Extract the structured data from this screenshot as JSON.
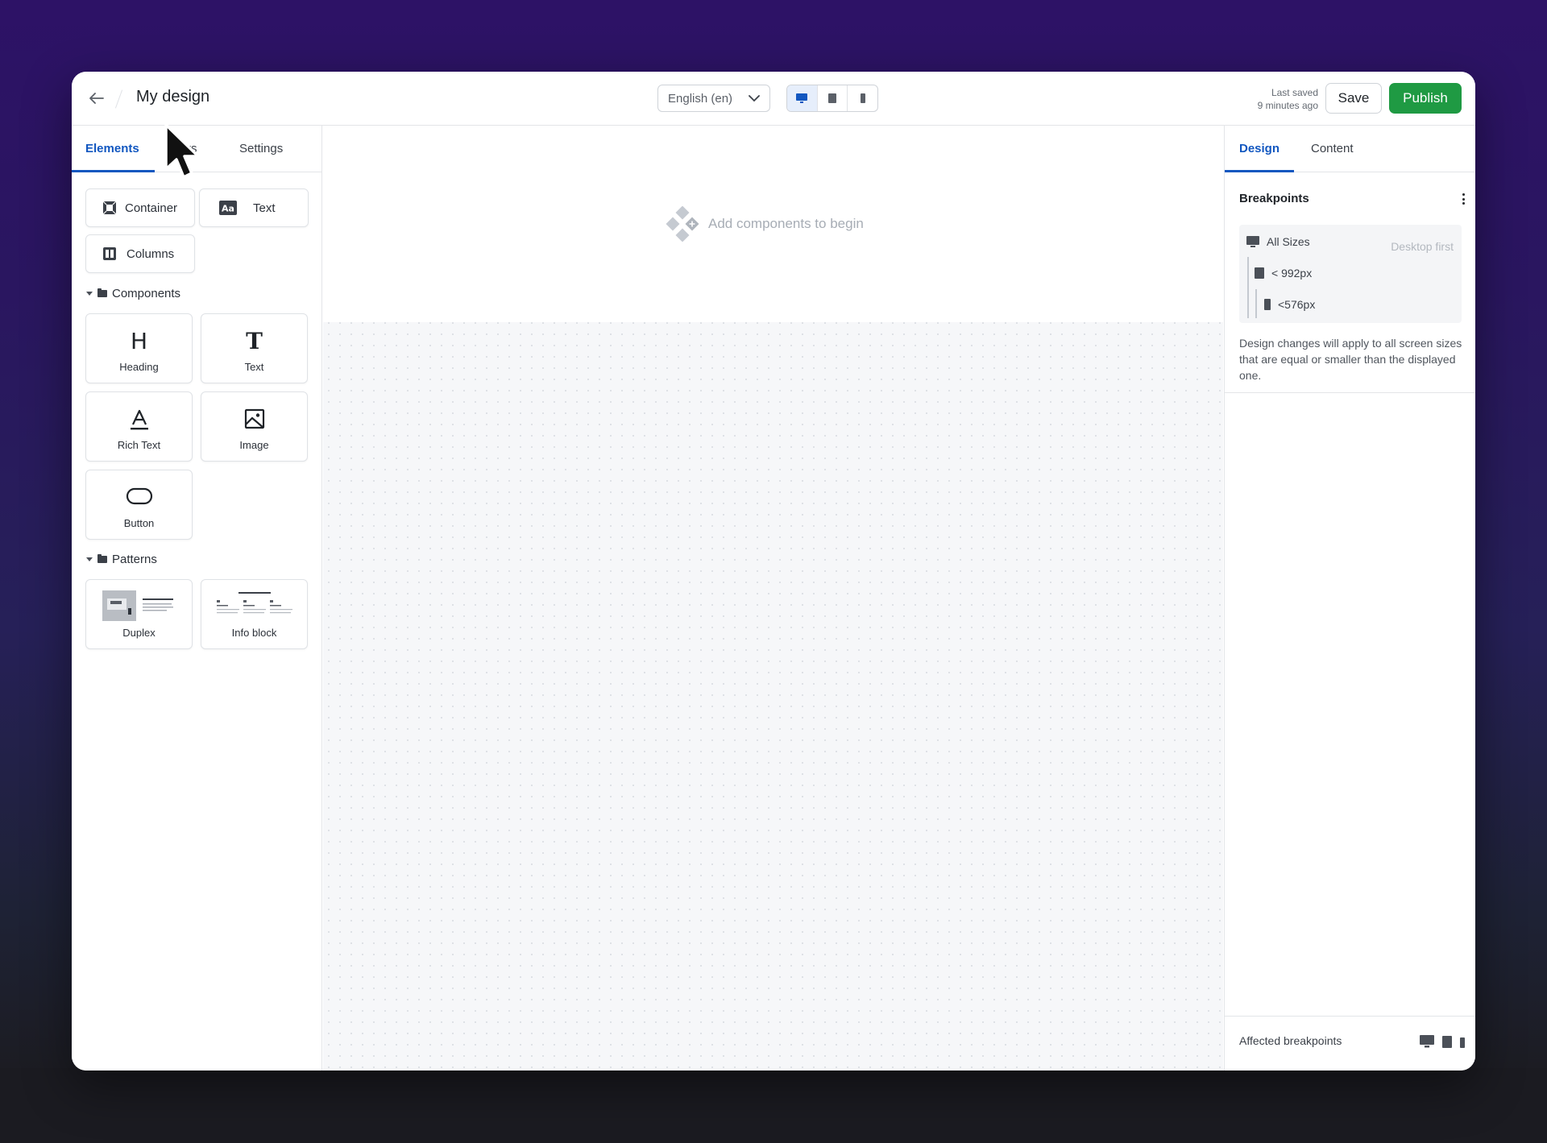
{
  "header": {
    "title": "My design",
    "language": "English (en)",
    "last_saved_line1": "Last saved",
    "last_saved_line2": "9 minutes ago",
    "save_label": "Save",
    "publish_label": "Publish",
    "devices": [
      "desktop-icon",
      "tablet-icon",
      "mobile-icon"
    ],
    "active_device": "desktop"
  },
  "left_panel": {
    "tabs": [
      "Elements",
      "rs",
      "Settings"
    ],
    "active_tab": "Elements",
    "layout_elements": [
      "Container",
      "Text",
      "Columns"
    ],
    "components_label": "Components",
    "components": [
      "Heading",
      "Text",
      "Rich Text",
      "Image",
      "Button"
    ],
    "patterns_label": "Patterns",
    "patterns": [
      "Duplex",
      "Info block"
    ]
  },
  "canvas": {
    "placeholder": "Add components to begin"
  },
  "right_panel": {
    "tabs": [
      "Design",
      "Content"
    ],
    "active_tab": "Design",
    "breakpoints_title": "Breakpoints",
    "breakpoints": [
      {
        "label": "All Sizes",
        "note": "Desktop first",
        "icon": "desktop-icon"
      },
      {
        "label": "< 992px",
        "icon": "tablet-icon"
      },
      {
        "label": "<576px",
        "icon": "mobile-icon"
      }
    ],
    "description": "Design changes will apply to all screen sizes that are equal or smaller than the displayed one.",
    "affected_label": "Affected breakpoints"
  },
  "colors": {
    "accent": "#1257c0",
    "publish": "#1f9a43",
    "background_top": "#2d1266"
  }
}
